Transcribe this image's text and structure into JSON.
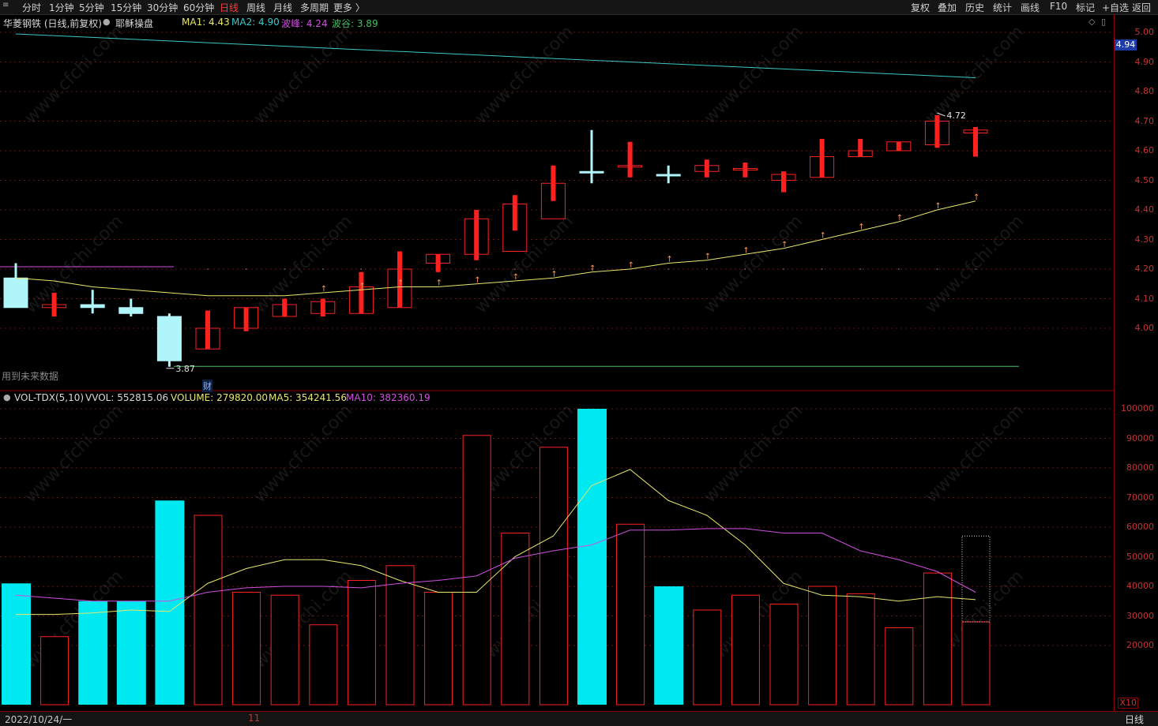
{
  "toolbar": {
    "periods": [
      "分时",
      "1分钟",
      "5分钟",
      "15分钟",
      "30分钟",
      "60分钟",
      "日线",
      "周线",
      "月线",
      "多周期",
      "更多 〉"
    ],
    "active_period": "日线",
    "right_tools": [
      "复权",
      "叠加",
      "历史",
      "统计",
      "画线",
      "F10",
      "标记",
      "+自选",
      "返回"
    ]
  },
  "price_header": {
    "title": "华菱钢铁 (日线,前复权)",
    "indicator_name": "耶稣操盘",
    "ma1": "MA1: 4.43",
    "ma2": "MA2: 4.90",
    "wave_peak": "波峰: 4.24",
    "wave_valley": "波谷: 3.89"
  },
  "future_data_note": "用到未来数据",
  "finance_marker": "财",
  "high_label": "4.72",
  "low_label": "3.87",
  "current_price_tag": "4.94",
  "vol_header": {
    "name": "VOL-TDX(5,10)",
    "vvol": "VVOL: 552815.06",
    "volume": "VOLUME: 279820.00",
    "ma5": "MA5: 354241.56",
    "ma10": "MA10: 382360.19"
  },
  "price_axis_ticks": [
    "5.00",
    "4.90",
    "4.80",
    "4.70",
    "4.60",
    "4.50",
    "4.40",
    "4.30",
    "4.20",
    "4.10",
    "4.00"
  ],
  "volume_axis_ticks": [
    "100000",
    "90000",
    "80000",
    "70000",
    "60000",
    "50000",
    "40000",
    "30000",
    "20000"
  ],
  "volume_unit": "X10",
  "bottom": {
    "date": "2022/10/24/一",
    "month_mark": "11",
    "period": "日线"
  },
  "colors": {
    "up": "#ff2020",
    "down": "#aff5fa",
    "vol_down": "#00e8f0",
    "ma_price": "#e6e66e",
    "ma2": "#3cc8c8",
    "purple": "#d050e0",
    "support": "#40c060",
    "grid": "#6e1010"
  },
  "chart_data": {
    "type": "candlestick",
    "price_range": [
      3.87,
      5.03
    ],
    "candles": [
      {
        "o": 4.17,
        "c": 4.07,
        "h": 4.22,
        "l": 4.07,
        "dir": "down"
      },
      {
        "o": 4.07,
        "c": 4.08,
        "h": 4.12,
        "l": 4.04,
        "dir": "up"
      },
      {
        "o": 4.08,
        "c": 4.07,
        "h": 4.13,
        "l": 4.05,
        "dir": "down"
      },
      {
        "o": 4.07,
        "c": 4.05,
        "h": 4.1,
        "l": 4.04,
        "dir": "down"
      },
      {
        "o": 4.04,
        "c": 3.89,
        "h": 4.05,
        "l": 3.87,
        "dir": "down"
      },
      {
        "o": 3.93,
        "c": 4.0,
        "h": 4.06,
        "l": 3.93,
        "dir": "up"
      },
      {
        "o": 4.0,
        "c": 4.07,
        "h": 4.07,
        "l": 3.99,
        "dir": "up"
      },
      {
        "o": 4.04,
        "c": 4.08,
        "h": 4.1,
        "l": 4.04,
        "dir": "up"
      },
      {
        "o": 4.05,
        "c": 4.09,
        "h": 4.1,
        "l": 4.04,
        "dir": "up"
      },
      {
        "o": 4.05,
        "c": 4.14,
        "h": 4.19,
        "l": 4.05,
        "dir": "up"
      },
      {
        "o": 4.07,
        "c": 4.2,
        "h": 4.26,
        "l": 4.07,
        "dir": "up"
      },
      {
        "o": 4.22,
        "c": 4.25,
        "h": 4.25,
        "l": 4.19,
        "dir": "up"
      },
      {
        "o": 4.25,
        "c": 4.37,
        "h": 4.4,
        "l": 4.23,
        "dir": "up"
      },
      {
        "o": 4.26,
        "c": 4.42,
        "h": 4.45,
        "l": 4.33,
        "dir": "up"
      },
      {
        "o": 4.37,
        "c": 4.49,
        "h": 4.55,
        "l": 4.43,
        "dir": "up"
      },
      {
        "o": 4.53,
        "c": 4.53,
        "h": 4.67,
        "l": 4.49,
        "dir": "down"
      },
      {
        "o": 4.55,
        "c": 4.55,
        "h": 4.63,
        "l": 4.51,
        "dir": "up"
      },
      {
        "o": 4.52,
        "c": 4.52,
        "h": 4.55,
        "l": 4.49,
        "dir": "down"
      },
      {
        "o": 4.53,
        "c": 4.55,
        "h": 4.57,
        "l": 4.51,
        "dir": "up"
      },
      {
        "o": 4.54,
        "c": 4.54,
        "h": 4.56,
        "l": 4.51,
        "dir": "up"
      },
      {
        "o": 4.5,
        "c": 4.52,
        "h": 4.53,
        "l": 4.46,
        "dir": "up"
      },
      {
        "o": 4.51,
        "c": 4.58,
        "h": 4.64,
        "l": 4.51,
        "dir": "up"
      },
      {
        "o": 4.58,
        "c": 4.6,
        "h": 4.64,
        "l": 4.58,
        "dir": "up"
      },
      {
        "o": 4.6,
        "c": 4.63,
        "h": 4.63,
        "l": 4.6,
        "dir": "up"
      },
      {
        "o": 4.62,
        "c": 4.7,
        "h": 4.72,
        "l": 4.61,
        "dir": "up"
      },
      {
        "o": 4.67,
        "c": 4.66,
        "h": 4.68,
        "l": 4.58,
        "dir": "up"
      }
    ],
    "ma1": [
      4.17,
      4.16,
      4.14,
      4.13,
      4.12,
      4.11,
      4.11,
      4.11,
      4.12,
      4.13,
      4.14,
      4.14,
      4.15,
      4.16,
      4.17,
      4.19,
      4.2,
      4.22,
      4.23,
      4.25,
      4.27,
      4.3,
      4.33,
      4.36,
      4.4,
      4.43
    ],
    "ma2_range": [
      5.0,
      4.9
    ],
    "volume": [
      41000,
      23000,
      35000,
      35000,
      69000,
      64000,
      38000,
      37000,
      27000,
      42000,
      47000,
      38000,
      91000,
      58000,
      87000,
      100000,
      61000,
      40000,
      32000,
      37000,
      34000,
      40000,
      37500,
      26000,
      44500,
      28000
    ],
    "vol_ma5": [
      30500,
      30500,
      31000,
      32000,
      31500,
      41000,
      46000,
      49000,
      49000,
      47000,
      42000,
      38000,
      38000,
      50000,
      57000,
      74000,
      79500,
      69000,
      64000,
      54000,
      41000,
      37000,
      36500,
      35000,
      36500,
      35500
    ],
    "vol_ma10": [
      37000,
      36000,
      35000,
      35000,
      35000,
      38000,
      39500,
      40000,
      40000,
      39500,
      41000,
      42000,
      43500,
      49500,
      52000,
      54000,
      59000,
      59000,
      59500,
      59500,
      58000,
      58000,
      52000,
      49000,
      45000,
      38000
    ]
  }
}
